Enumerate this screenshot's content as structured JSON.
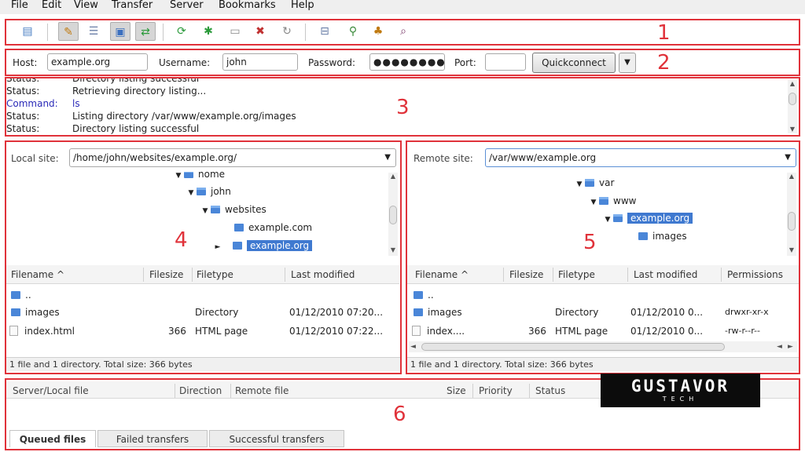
{
  "menu": [
    "File",
    "Edit",
    "View",
    "Transfer",
    "Server",
    "Bookmarks",
    "Help"
  ],
  "toolbar": {
    "icons": [
      "site-manager-icon",
      "toggle-log-icon",
      "toggle-local-tree-icon",
      "toggle-remote-tree-icon",
      "toggle-queue-icon",
      "refresh-icon",
      "process-queue-icon",
      "cancel-icon",
      "disconnect-icon",
      "reconnect-icon",
      "filter-icon",
      "compare-icon",
      "sync-browse-icon",
      "search-icon"
    ]
  },
  "quickconnect": {
    "host_label": "Host:",
    "host_value": "example.org",
    "username_label": "Username:",
    "username_value": "john",
    "password_label": "Password:",
    "password_value": "●●●●●●●●",
    "port_label": "Port:",
    "port_value": "",
    "button_label": "Quickconnect",
    "dropdown_glyph": "▼"
  },
  "log": [
    {
      "label": "Status:",
      "message": "Directory listing successful",
      "type": "status"
    },
    {
      "label": "Status:",
      "message": "Retrieving directory listing...",
      "type": "status"
    },
    {
      "label": "Command:",
      "message": "ls",
      "type": "command"
    },
    {
      "label": "Status:",
      "message": "Listing directory /var/www/example.org/images",
      "type": "status"
    },
    {
      "label": "Status:",
      "message": "Directory listing successful",
      "type": "status"
    }
  ],
  "local": {
    "site_label": "Local site:",
    "path": "/home/john/websites/example.org/",
    "tree": [
      "home",
      "john",
      "websites",
      "example.com",
      "example.org"
    ],
    "columns": [
      "Filename",
      "Filesize",
      "Filetype",
      "Last modified"
    ],
    "sort_glyph": "^",
    "files": [
      {
        "name": "..",
        "size": "",
        "type": "",
        "modified": ""
      },
      {
        "name": "images",
        "size": "",
        "type": "Directory",
        "modified": "01/12/2010 07:20..."
      },
      {
        "name": "index.html",
        "size": "366",
        "type": "HTML page",
        "modified": "01/12/2010 07:22..."
      }
    ],
    "status": "1 file and 1 directory. Total size: 366 bytes"
  },
  "remote": {
    "site_label": "Remote site:",
    "path": "/var/www/example.org",
    "tree": [
      "var",
      "www",
      "example.org",
      "images"
    ],
    "columns": [
      "Filename",
      "Filesize",
      "Filetype",
      "Last modified",
      "Permissions"
    ],
    "sort_glyph": "^",
    "files": [
      {
        "name": "..",
        "size": "",
        "type": "",
        "modified": "",
        "perms": ""
      },
      {
        "name": "images",
        "size": "",
        "type": "Directory",
        "modified": "01/12/2010 0...",
        "perms": "drwxr-xr-x"
      },
      {
        "name": "index....",
        "size": "366",
        "type": "HTML page",
        "modified": "01/12/2010 0...",
        "perms": "-rw-r--r--"
      }
    ],
    "status": "1 file and 1 directory. Total size: 366 bytes"
  },
  "queue": {
    "columns": [
      "Server/Local file",
      "Direction",
      "Remote file",
      "Size",
      "Priority",
      "Status"
    ],
    "tabs": [
      "Queued files",
      "Failed transfers",
      "Successful transfers"
    ]
  },
  "regions": [
    "1",
    "2",
    "3",
    "4",
    "5",
    "6"
  ],
  "logo": {
    "main": "GUSTAVOR",
    "sub": "TECH"
  },
  "colors": {
    "annotation": "#e0323a",
    "selection": "#3f79d0",
    "command": "#2a2ab8",
    "folder": "#4a86d8"
  }
}
